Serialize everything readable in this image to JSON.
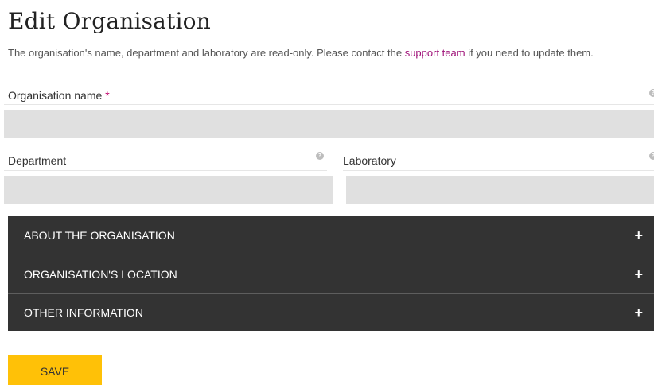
{
  "page": {
    "title": "Edit Organisation",
    "intro_before": "The organisation's name, department and laboratory are read-only. Please contact the ",
    "intro_link": "support team",
    "intro_after": " if you need to update them."
  },
  "fields": {
    "organisation_name": {
      "label": "Organisation name",
      "required_mark": "*",
      "value": ""
    },
    "department": {
      "label": "Department",
      "value": ""
    },
    "laboratory": {
      "label": "Laboratory",
      "value": ""
    }
  },
  "icons": {
    "help": "question-circle-icon",
    "expand": "plus-icon"
  },
  "accordion": [
    {
      "label": "ABOUT THE ORGANISATION",
      "toggle": "+"
    },
    {
      "label": "ORGANISATION'S LOCATION",
      "toggle": "+"
    },
    {
      "label": "OTHER INFORMATION",
      "toggle": "+"
    }
  ],
  "actions": {
    "save_label": "SAVE"
  },
  "colors": {
    "accent_link": "#a0147a",
    "required": "#c0006a",
    "accordion_bg": "#333333",
    "save_button": "#ffc107",
    "field_bg": "#e0e0e0"
  }
}
